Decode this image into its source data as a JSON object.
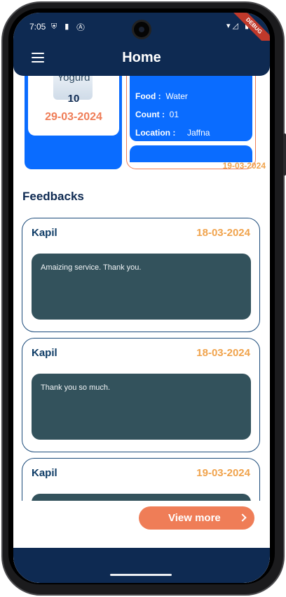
{
  "status_bar": {
    "time": "7:05",
    "left_icons": "⛨ ▮ Ⓐ",
    "right_icons": "▾◿ ▮",
    "debug_label": "DEBUG"
  },
  "app_bar": {
    "title": "Home"
  },
  "donation_left": {
    "name": "Yogurd",
    "count": "10",
    "date": "29-03-2024"
  },
  "donation_right": {
    "food_label": "Food :",
    "food_value": "Water",
    "count_label": "Count :",
    "count_value": "01",
    "location_label": "Location :",
    "location_value": "Jaffna",
    "date": "19-03-2024"
  },
  "feedbacks": {
    "title": "Feedbacks",
    "items": [
      {
        "name": "Kapil",
        "date": "18-03-2024",
        "text": "Amaizing service. Thank you."
      },
      {
        "name": "Kapil",
        "date": "18-03-2024",
        "text": "Thank you so much."
      },
      {
        "name": "Kapil",
        "date": "19-03-2024",
        "text": ""
      }
    ]
  },
  "view_more": {
    "label": "View more"
  },
  "colors": {
    "navy": "#0e2a52",
    "blue": "#0a6cff",
    "orange": "#ef7d57",
    "gold": "#f0a34c",
    "card_dark": "#33525c"
  }
}
